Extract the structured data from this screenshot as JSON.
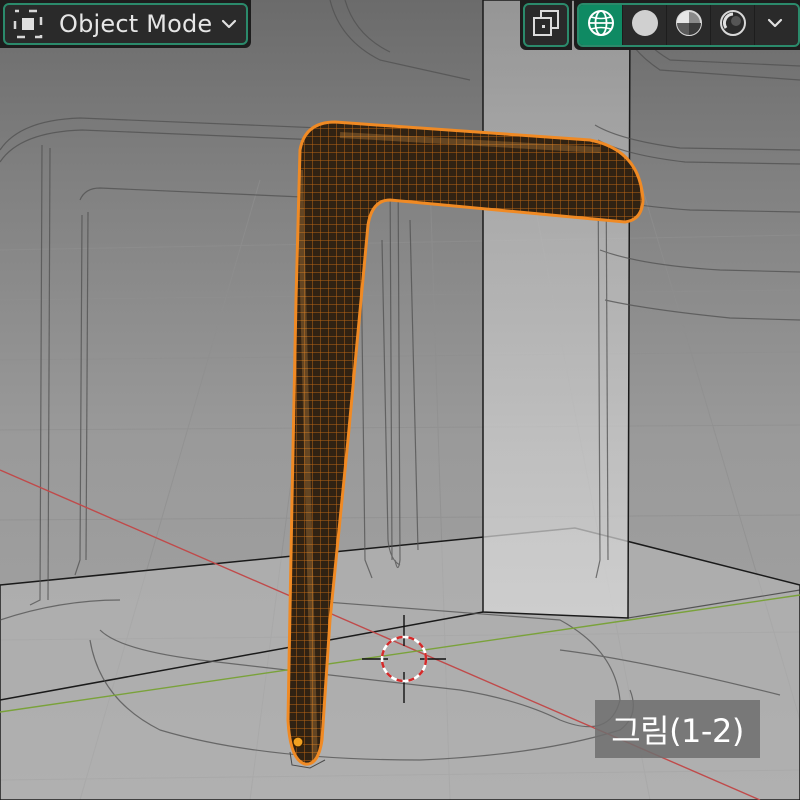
{
  "header": {
    "mode_selector": {
      "label": "Object Mode",
      "icon": "object-mode-icon",
      "dropdown_icon": "chevron-down-icon"
    },
    "overlay_toggle": {
      "icon": "xray-toggle-icon"
    },
    "shading": {
      "buttons": [
        {
          "icon": "wireframe-shading-icon",
          "active": true
        },
        {
          "icon": "solid-shading-icon",
          "active": false
        },
        {
          "icon": "material-preview-icon",
          "active": false
        },
        {
          "icon": "rendered-shading-icon",
          "active": false
        }
      ],
      "dropdown_icon": "chevron-down-icon"
    },
    "accent_color": "#2b8a6b",
    "active_color": "#0f8a63"
  },
  "viewport": {
    "selected_object_color": "#f08a24",
    "x_axis_color": "#c04a4a",
    "y_axis_color": "#7aa23a",
    "cursor_icon": "3d-cursor-icon",
    "origin_icon": "object-origin-icon"
  },
  "caption": {
    "text": "그림(1-2)"
  }
}
